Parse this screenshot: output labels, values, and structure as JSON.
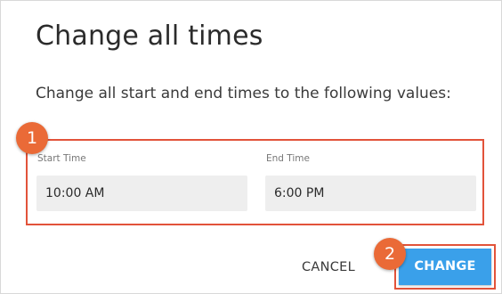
{
  "dialog": {
    "title": "Change all times",
    "description": "Change all start and end times to the following values:"
  },
  "fields": {
    "start_label": "Start Time",
    "start_value": "10:00 AM",
    "end_label": "End Time",
    "end_value": "6:00 PM"
  },
  "actions": {
    "cancel_label": "CANCEL",
    "change_label": "CHANGE"
  },
  "callouts": {
    "one": "1",
    "two": "2"
  },
  "colors": {
    "accent": "#3aa0ea",
    "callout": "#ea6a37",
    "highlight_border": "#e2533a",
    "field_bg": "#eeeeee"
  }
}
